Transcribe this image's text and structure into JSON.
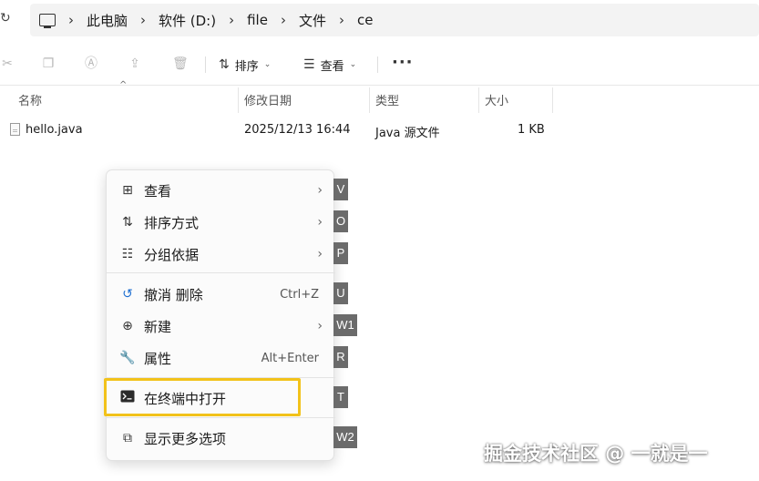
{
  "address_bar": {
    "breadcrumbs": [
      "此电脑",
      "软件 (D:)",
      "file",
      "文件",
      "ce"
    ]
  },
  "toolbar": {
    "sort_label": "排序",
    "view_label": "查看",
    "more_label": "···"
  },
  "columns": {
    "name": "名称",
    "modified": "修改日期",
    "type": "类型",
    "size": "大小"
  },
  "files": [
    {
      "name": "hello.java",
      "modified": "2025/12/13 16:44",
      "type": "Java 源文件",
      "size": "1 KB"
    }
  ],
  "context_menu": {
    "items": [
      {
        "label": "查看",
        "icon": "grid-icon",
        "has_submenu": true,
        "access_key": "V"
      },
      {
        "label": "排序方式",
        "icon": "sort-icon",
        "has_submenu": true,
        "access_key": "O"
      },
      {
        "label": "分组依据",
        "icon": "group-icon",
        "has_submenu": true,
        "access_key": "P"
      },
      {
        "label": "撤消 删除",
        "icon": "undo-icon",
        "shortcut": "Ctrl+Z",
        "access_key": "U"
      },
      {
        "label": "新建",
        "icon": "plus-circle-icon",
        "has_submenu": true,
        "access_key": "W1"
      },
      {
        "label": "属性",
        "icon": "wrench-icon",
        "shortcut": "Alt+Enter",
        "access_key": "R"
      },
      {
        "label": "在终端中打开",
        "icon": "terminal-icon",
        "access_key": "T",
        "highlighted": true
      },
      {
        "label": "显示更多选项",
        "icon": "external-icon",
        "access_key": "W2"
      }
    ]
  },
  "highlight_color": "#f2c21a",
  "watermark": "掘金技术社区 @ 一就是一"
}
